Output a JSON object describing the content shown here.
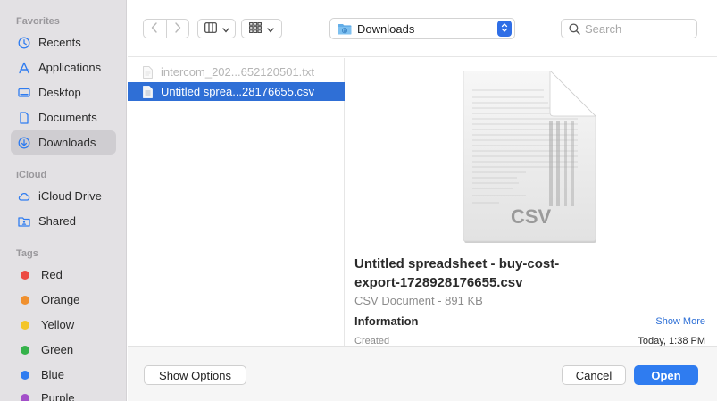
{
  "sidebar": {
    "favorites_header": "Favorites",
    "favorites": [
      {
        "label": "Recents",
        "icon": "clock-icon"
      },
      {
        "label": "Applications",
        "icon": "applications-icon"
      },
      {
        "label": "Desktop",
        "icon": "desktop-icon"
      },
      {
        "label": "Documents",
        "icon": "document-icon"
      },
      {
        "label": "Downloads",
        "icon": "download-icon",
        "selected": true
      }
    ],
    "icloud_header": "iCloud",
    "icloud": [
      {
        "label": "iCloud Drive",
        "icon": "cloud-icon"
      },
      {
        "label": "Shared",
        "icon": "shared-folder-icon"
      }
    ],
    "tags_header": "Tags",
    "tags": [
      {
        "label": "Red",
        "color": "#ec4a43"
      },
      {
        "label": "Orange",
        "color": "#f0902e"
      },
      {
        "label": "Yellow",
        "color": "#f3c52a"
      },
      {
        "label": "Green",
        "color": "#35b24a"
      },
      {
        "label": "Blue",
        "color": "#2f7cf0"
      },
      {
        "label": "Purple",
        "color": "#a34fc9"
      }
    ]
  },
  "toolbar": {
    "location": "Downloads",
    "search_placeholder": "Search",
    "search_value": ""
  },
  "files": [
    {
      "name": "intercom_202...652120501.txt",
      "disabled": true
    },
    {
      "name": "Untitled sprea...28176655.csv",
      "selected": true
    }
  ],
  "preview": {
    "thumb_label": "CSV",
    "name": "Untitled spreadsheet - buy-cost-export-1728928176655.csv",
    "kind_size": "CSV Document - 891 KB",
    "info_header": "Information",
    "show_more": "Show More",
    "created_label": "Created",
    "created_value": "Today, 1:38 PM"
  },
  "buttons": {
    "show_options": "Show Options",
    "cancel": "Cancel",
    "open": "Open"
  },
  "colors": {
    "accent": "#2f7cf0",
    "selection": "#2f6fd6"
  }
}
